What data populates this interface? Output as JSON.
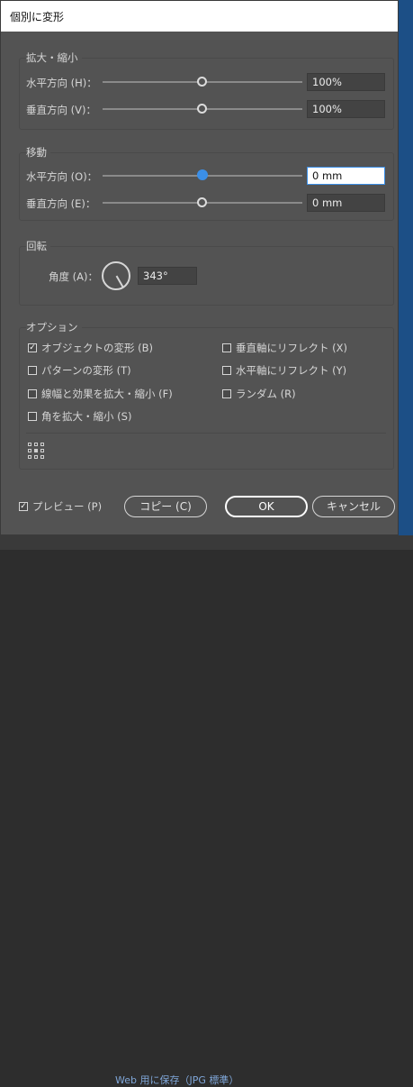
{
  "window": {
    "title": "個別に変形"
  },
  "scale": {
    "legend": "拡大・縮小",
    "horizontal": {
      "label": "水平方向 (H)：",
      "value": "100%"
    },
    "vertical": {
      "label": "垂直方向 (V)：",
      "value": "100%"
    }
  },
  "move": {
    "legend": "移動",
    "horizontal": {
      "label": "水平方向 (O)：",
      "value": "0 mm"
    },
    "vertical": {
      "label": "垂直方向 (E)：",
      "value": "0 mm"
    }
  },
  "rotate": {
    "legend": "回転",
    "angle_label": "角度 (A)：",
    "angle_value": "343°"
  },
  "options": {
    "legend": "オプション",
    "transform_objects": {
      "label": "オブジェクトの変形 (B)",
      "checked": true
    },
    "transform_patterns": {
      "label": "パターンの変形 (T)",
      "checked": false
    },
    "scale_strokes": {
      "label": "線幅と効果を拡大・縮小 (F)",
      "checked": false
    },
    "scale_corners": {
      "label": "角を拡大・縮小 (S)",
      "checked": false
    },
    "reflect_vertical": {
      "label": "垂直軸にリフレクト (X)",
      "checked": false
    },
    "reflect_horizontal": {
      "label": "水平軸にリフレクト (Y)",
      "checked": false
    },
    "random": {
      "label": "ランダム (R)",
      "checked": false
    }
  },
  "footer": {
    "preview_label": "プレビュー (P)",
    "preview_checked": true,
    "copy_label": "コピー (C)",
    "ok_label": "OK",
    "cancel_label": "キャンセル"
  },
  "background": {
    "text": "Web 用に保存（JPG 標準）"
  },
  "icons": {
    "checkmark": "✓",
    "reference_point": "reference-point-grid-icon"
  },
  "colors": {
    "accent": "#3b8fe8",
    "dialog_bg": "#535353"
  }
}
